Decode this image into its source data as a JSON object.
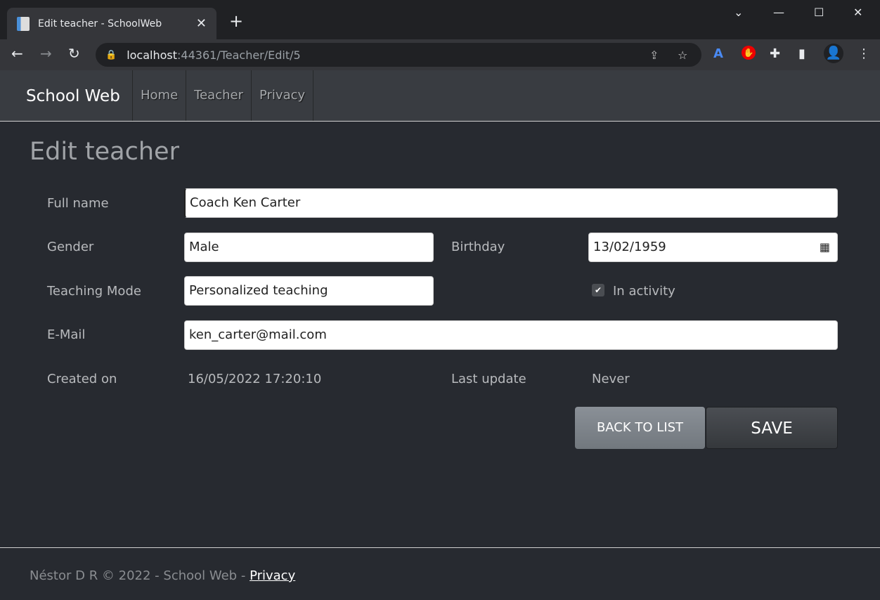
{
  "browser": {
    "tab_title": "Edit teacher - SchoolWeb",
    "url_host": "localhost",
    "url_path": ":44361/Teacher/Edit/5"
  },
  "site": {
    "brand": "School Web",
    "nav": [
      "Home",
      "Teacher",
      "Privacy"
    ]
  },
  "page": {
    "title": "Edit teacher"
  },
  "form": {
    "full_name": {
      "label": "Full name",
      "value": "Coach Ken Carter"
    },
    "gender": {
      "label": "Gender",
      "value": "Male"
    },
    "birthday": {
      "label": "Birthday",
      "value": "13/02/1959"
    },
    "teaching_mode": {
      "label": "Teaching Mode",
      "value": "Personalized teaching"
    },
    "in_activity": {
      "label": "In activity",
      "checked": true
    },
    "email": {
      "label": "E-Mail",
      "value": "ken_carter@mail.com"
    },
    "created_on": {
      "label": "Created on",
      "value": "16/05/2022 17:20:10"
    },
    "last_update": {
      "label": "Last update",
      "value": "Never"
    },
    "back_label": "BACK TO LIST",
    "save_label": "SAVE"
  },
  "footer": {
    "text": "Néstor D R © 2022 - School Web - ",
    "link": "Privacy"
  }
}
